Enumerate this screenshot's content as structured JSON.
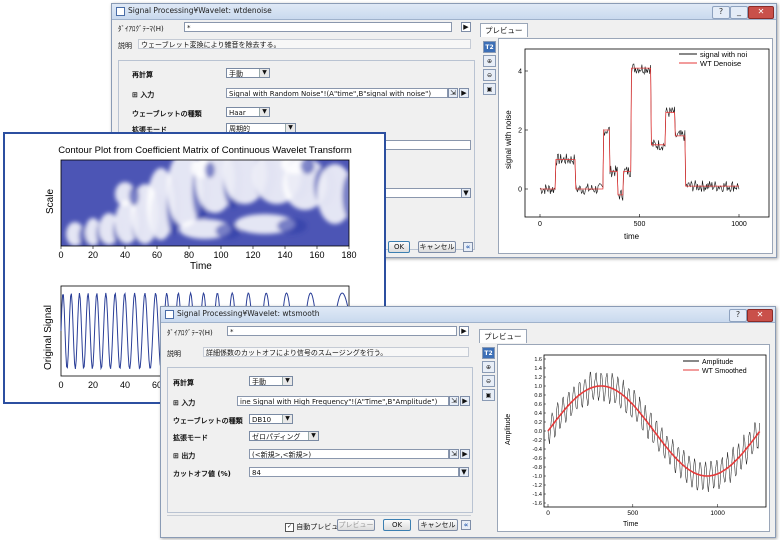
{
  "win1": {
    "title": "Signal Processing¥Wavelet: wtdenoise",
    "theme_label": "ﾀﾞｲｱﾛｸﾞﾃｰﾏ(H)",
    "theme_value": "*",
    "desc_label": "説明",
    "desc_value": "ウェーブレット変換により雑音を除去する。",
    "recalc_label": "再計算",
    "recalc_value": "手動",
    "input_label": "入力",
    "input_value": "Signal with Random Noise\"!(A\"time\",B\"signal with noise\")",
    "wavelet_label": "ウェーブレットの種類",
    "wavelet_value": "Haar",
    "ext_label": "拡張モード",
    "ext_value": "周期的",
    "ok": "OK",
    "cancel": "キャンセル",
    "preview_tab": "プレビュー",
    "t2": "T2",
    "expand": "«",
    "chart": {
      "ylabel": "signal with noise",
      "xlabel": "time",
      "legend1": "signal with noi",
      "legend2": "WT Denoise",
      "xticks": [
        "0",
        "500",
        "1000"
      ],
      "yticks": [
        "0",
        "2",
        "4"
      ]
    }
  },
  "plot": {
    "title": "Contour Plot from Coefficient Matrix of Continuous Wavelet Transform",
    "scale_label": "Scale",
    "time_label": "Time",
    "time_ticks": [
      "0",
      "20",
      "40",
      "60",
      "80",
      "100",
      "120",
      "140",
      "160",
      "180"
    ],
    "orig_label": "Original Signal",
    "lower_ticks": [
      "0",
      "20",
      "40",
      "60"
    ]
  },
  "win2": {
    "title": "Signal Processing¥Wavelet: wtsmooth",
    "theme_label": "ﾀﾞｲｱﾛｸﾞﾃｰﾏ(H)",
    "theme_value": "*",
    "desc_label": "説明",
    "desc_value": "詳細係数のカットオフにより信号のスムージングを行う。",
    "recalc_label": "再計算",
    "recalc_value": "手動",
    "input_label": "入力",
    "input_value": "ine Signal with High Frequency\"!(A\"Time\",B\"Amplitude\")",
    "wavelet_label": "ウェーブレットの種類",
    "wavelet_value": "DB10",
    "ext_label": "拡張モード",
    "ext_value": "ゼロパディング",
    "output_label": "出力",
    "output_value": "(<新規>,<新規>)",
    "cutoff_label": "カットオフ値 (%)",
    "cutoff_value": "84",
    "auto_preview": "自動プレビュー",
    "preview_btn": "プレビュー",
    "ok": "OK",
    "cancel": "キャンセル",
    "preview_tab": "プレビュー",
    "t2": "T2",
    "expand": "«",
    "chart": {
      "ylabel": "Amplitude",
      "xlabel": "Time",
      "legend1": "Amplitude",
      "legend2": "WT Smoothed",
      "xticks": [
        "0",
        "500",
        "1000"
      ],
      "yticks": [
        "1.6",
        "1.4",
        "1.2",
        "1.0",
        "0.8",
        "0.6",
        "0.4",
        "0.2",
        "0.0",
        "-0.2",
        "-0.4",
        "-0.6",
        "-0.8",
        "-1.0",
        "-1.2",
        "-1.4",
        "-1.6"
      ]
    }
  }
}
